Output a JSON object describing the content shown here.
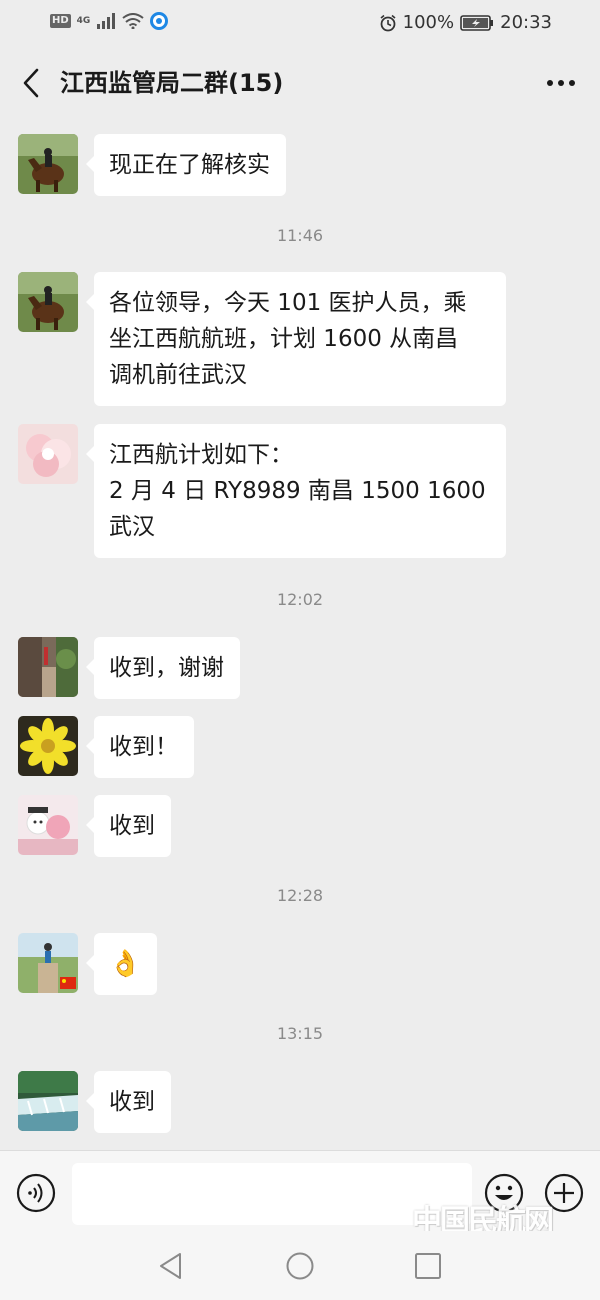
{
  "status_bar": {
    "hd": "HD",
    "network": "4G",
    "battery": "100%",
    "time": "20:33"
  },
  "header": {
    "title": "江西监管局二群(15)"
  },
  "messages": [
    {
      "type": "message",
      "avatar": "horse-rider-avatar",
      "text": "现正在了解核实"
    },
    {
      "type": "timestamp",
      "text": "11:46"
    },
    {
      "type": "message",
      "avatar": "horse-rider-avatar",
      "text": "各位领导，今天 101 医护人员，乘\n坐江西航航班，计划 1600 从南昌\n调机前往武汉"
    },
    {
      "type": "message",
      "avatar": "pink-flower-avatar",
      "text": "江西航计划如下：\n2 月 4 日 RY8989 南昌 1500 1600\n武汉"
    },
    {
      "type": "timestamp",
      "text": "12:02"
    },
    {
      "type": "message",
      "avatar": "street-avatar",
      "text": "收到，谢谢"
    },
    {
      "type": "message",
      "avatar": "yellow-flower-avatar",
      "text": "收到！"
    },
    {
      "type": "message",
      "avatar": "plush-toys-avatar",
      "text": "收到"
    },
    {
      "type": "timestamp",
      "text": "12:28"
    },
    {
      "type": "message",
      "avatar": "runner-avatar",
      "text": "👌"
    },
    {
      "type": "timestamp",
      "text": "13:15"
    },
    {
      "type": "message",
      "avatar": "waterfall-avatar",
      "text": "收到"
    }
  ],
  "watermark": "中国民航网",
  "colors": {
    "background": "#ededed",
    "bubble": "#ffffff",
    "timestamp_text": "#8a8a8a"
  }
}
